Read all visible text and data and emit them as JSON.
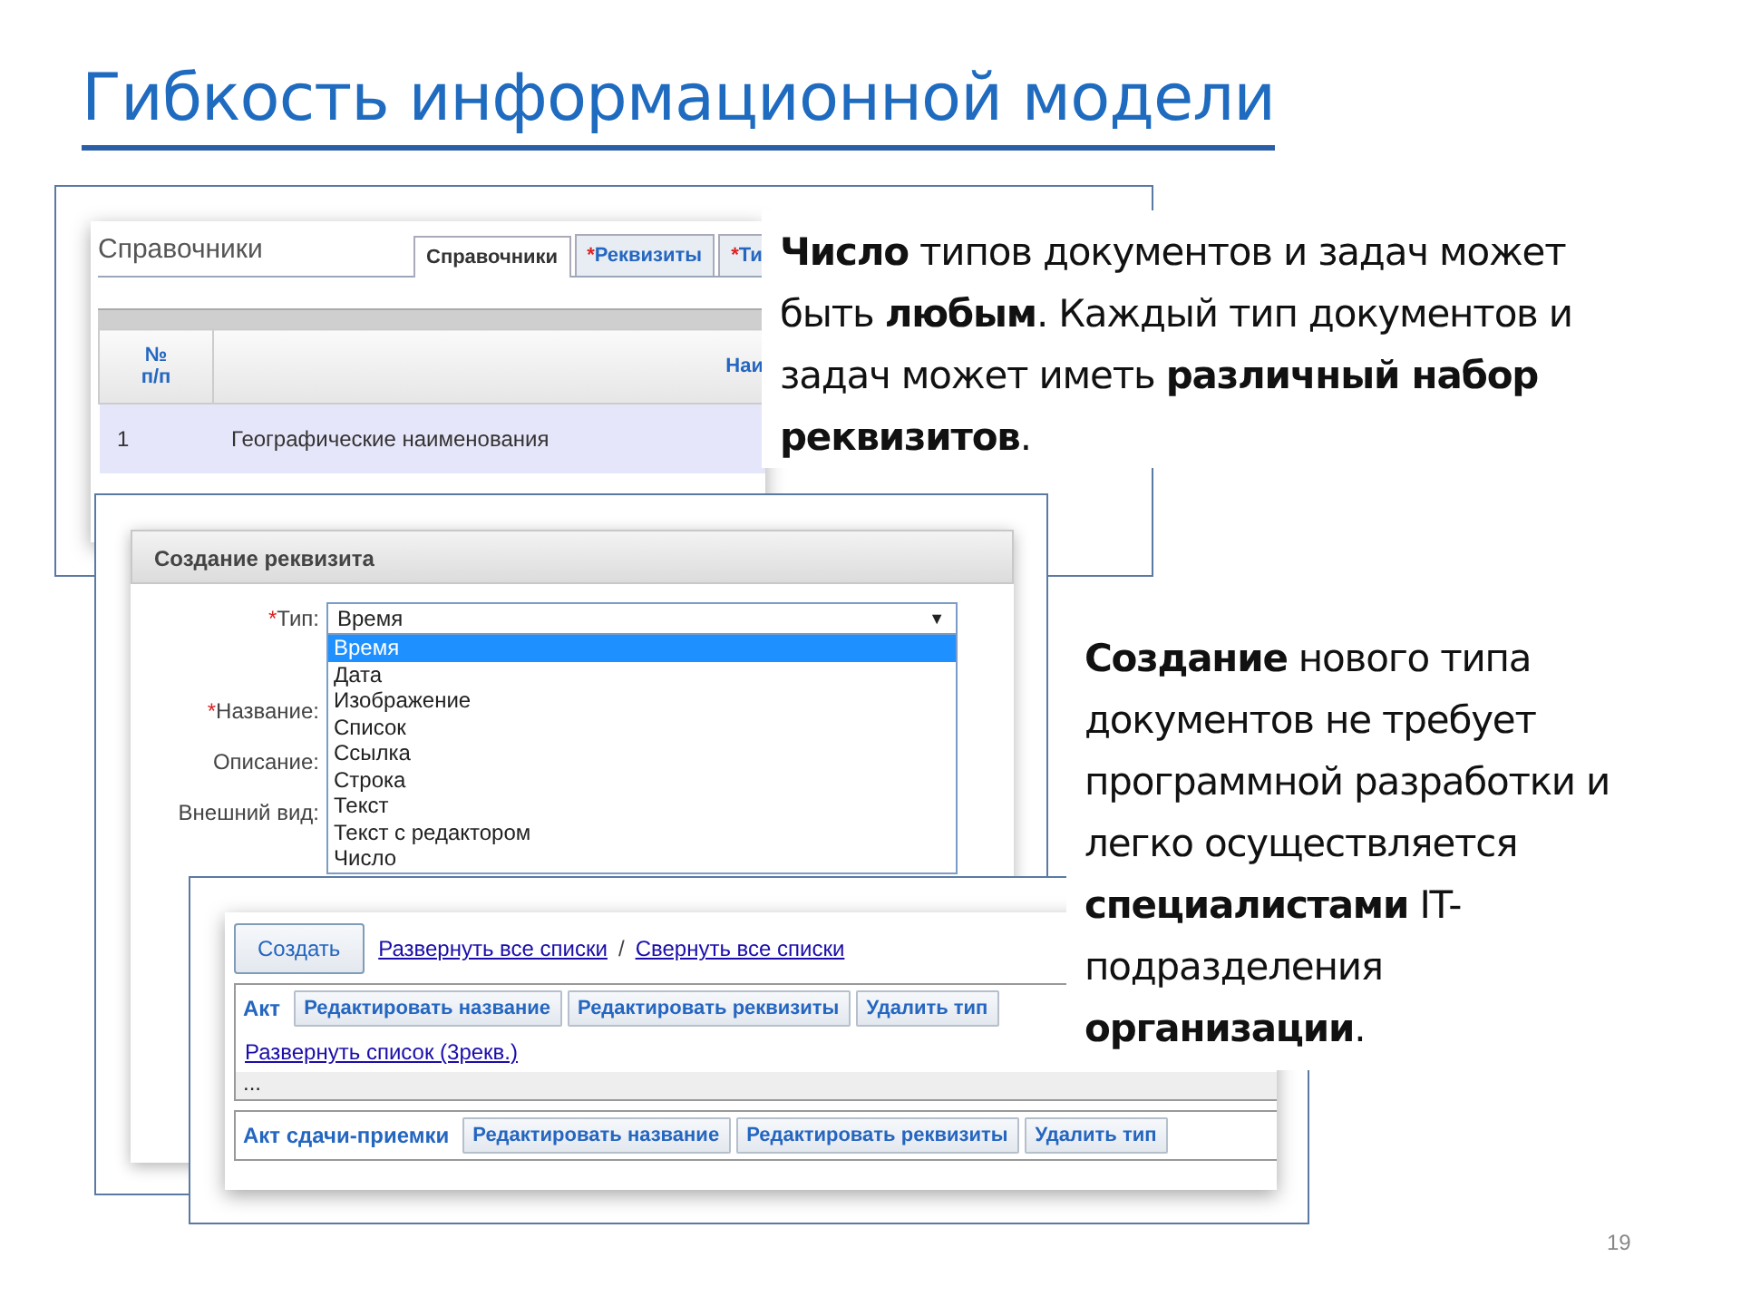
{
  "title": "Гибкость информационной модели",
  "directory_window": {
    "heading": "Справочники",
    "tabs": [
      {
        "label": "Справочники",
        "selected": true
      },
      {
        "mark": "*",
        "label": "Реквизиты",
        "selected": false
      },
      {
        "mark": "*",
        "label": "Ти",
        "selected": false
      }
    ],
    "columns": [
      "№\nп/п",
      "Наи"
    ],
    "rows": [
      {
        "cells": [
          "1",
          "Географические наименования"
        ],
        "selected": true
      }
    ]
  },
  "callouts": [
    {
      "text": "**Число** типов документов и задач может быть **любым**. Каждый тип документов и задач может иметь **различный набор реквизитов**."
    },
    {
      "text": "**Создание** нового типа документов не требует программной разработки и легко осуществляется **специалистами** IT-подразделения **организации**."
    }
  ],
  "attribute_window": {
    "title": "Создание реквизита",
    "fields": [
      {
        "mark": "*",
        "label": "Тип:"
      },
      {
        "mark": "*",
        "label": "Название:"
      },
      {
        "label": "Описание:"
      },
      {
        "label": "Внешний вид:"
      }
    ],
    "type_select": {
      "value": "Время",
      "arrow": "▼",
      "options": [
        {
          "label": "Время",
          "selected": true
        },
        {
          "label": "Дата",
          "selected": false
        },
        {
          "label": "Изображение",
          "selected": false
        },
        {
          "label": "Список",
          "selected": false
        },
        {
          "label": "Ссылка",
          "selected": false
        },
        {
          "label": "Строка",
          "selected": false
        },
        {
          "label": "Текст",
          "selected": false
        },
        {
          "label": "Текст с редактором",
          "selected": false
        },
        {
          "label": "Число",
          "selected": false
        }
      ]
    }
  },
  "types_window": {
    "create_button": "Создать",
    "links": [
      "Развернуть все списки",
      "Свернуть все списки"
    ],
    "separator": "/",
    "groups": [
      {
        "name": "Акт",
        "actions": [
          "Редактировать название",
          "Редактировать реквизиты",
          "Удалить тип"
        ],
        "expand_link": "Развернуть список (3рекв.)",
        "more": "..."
      },
      {
        "name": "Акт сдачи-приемки",
        "actions": [
          "Редактировать название",
          "Редактировать реквизиты",
          "Удалить тип"
        ]
      }
    ]
  },
  "page_number": "19"
}
